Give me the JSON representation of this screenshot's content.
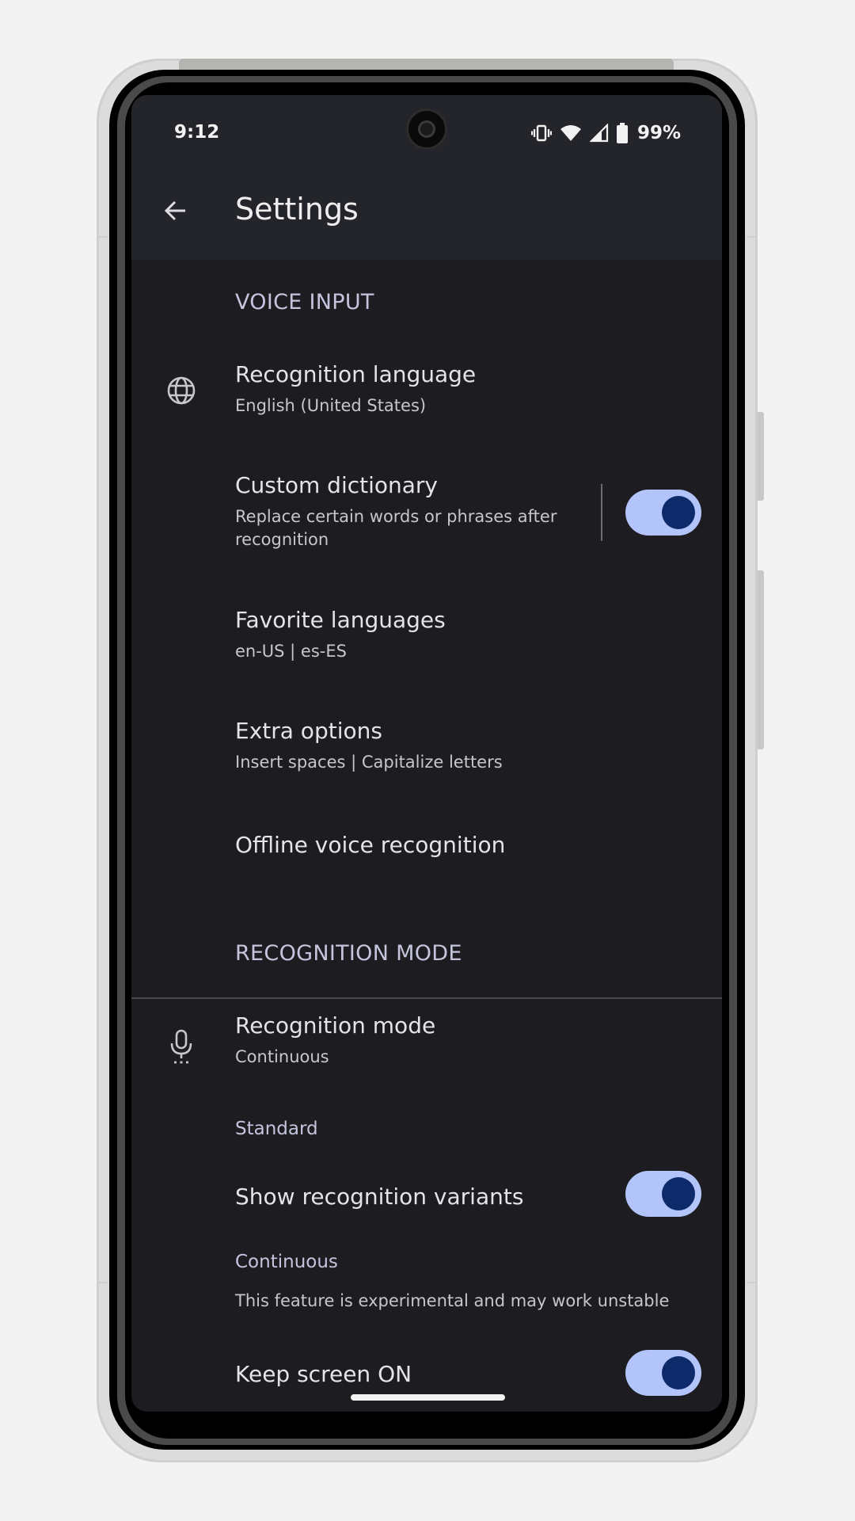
{
  "status_bar": {
    "time": "9:12",
    "battery_percent": "99%",
    "icons": [
      "vibrate-icon",
      "wifi-icon",
      "signal-icon",
      "battery-icon"
    ]
  },
  "app_bar": {
    "back_icon": "arrow-back-icon",
    "title": "Settings"
  },
  "sections": {
    "voice_input": {
      "header": "VOICE INPUT",
      "recognition_language": {
        "title": "Recognition language",
        "subtitle": "English (United States)",
        "icon": "globe-icon"
      },
      "custom_dictionary": {
        "title": "Custom dictionary",
        "subtitle_line1": "Replace certain words or phrases after",
        "subtitle_line2": "recognition",
        "toggle_on": true
      },
      "favorite_languages": {
        "title": "Favorite languages",
        "subtitle": "en-US | es-ES"
      },
      "extra_options": {
        "title": "Extra options",
        "subtitle": "Insert spaces | Capitalize letters"
      },
      "offline_recognition": {
        "title": "Offline voice recognition"
      }
    },
    "recognition_mode": {
      "header": "RECOGNITION MODE",
      "mode": {
        "title": "Recognition mode",
        "subtitle": "Continuous",
        "icon": "microphone-icon"
      },
      "standard_header": "Standard",
      "show_variants": {
        "title": "Show recognition variants",
        "toggle_on": true
      },
      "continuous_header": "Continuous",
      "experimental_note": "This feature is experimental and may work unstable",
      "keep_screen_on": {
        "title": "Keep screen ON",
        "toggle_on": true
      }
    }
  },
  "colors": {
    "background": "#1d1c21",
    "app_bar": "#24252a",
    "toggle_track": "#b2c4f9",
    "toggle_knob": "#0d2a6b",
    "section_header": "#c4c5dd"
  }
}
